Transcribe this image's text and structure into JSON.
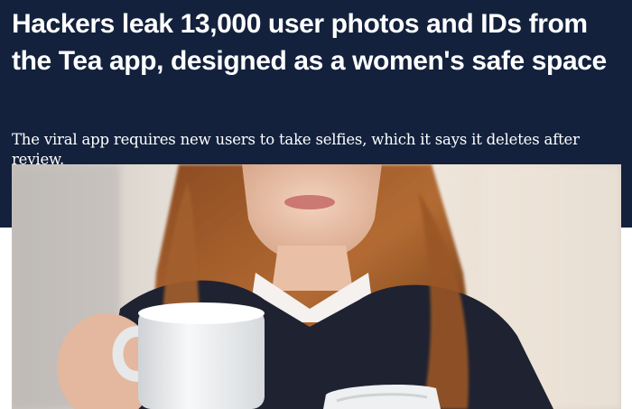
{
  "article": {
    "headline": "Hackers leak 13,000 user photos and IDs from the Tea app, designed as a women's safe space",
    "subheadline": "The viral app requires new users to take selfies, which it says it deletes after review."
  },
  "photo": {
    "icon": "photo-woman-coffee-phone"
  },
  "colors": {
    "hero_background": "#13213d",
    "text": "#ffffff"
  }
}
